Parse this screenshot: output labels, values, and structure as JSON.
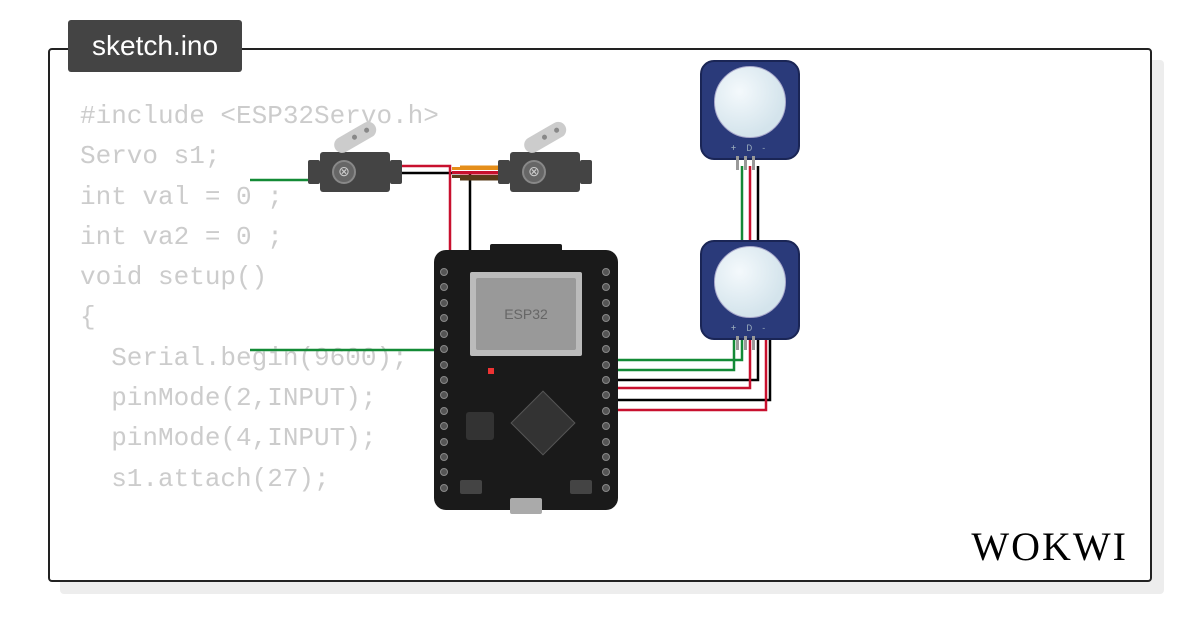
{
  "tab_label": "sketch.ino",
  "logo_text": "WOKWI",
  "code_text": "#include <ESP32Servo.h>\nServo s1;\nint val = 0 ;\nint va2 = 0 ;\nvoid setup()\n{\n  Serial.begin(9600);\n  pinMode(2,INPUT);\n  pinMode(4,INPUT);\n  s1.attach(27);",
  "board": {
    "chip_label": "ESP32"
  },
  "components": {
    "servo1": "wokwi-servo",
    "servo2": "wokwi-servo",
    "pir1": "wokwi-pir-motion-sensor",
    "pir2": "wokwi-pir-motion-sensor",
    "mcu": "wokwi-esp32-devkit-v1"
  },
  "pir_pin_label": "+ D -",
  "wire_colors": {
    "gnd": "#000000",
    "vcc": "#c8102e",
    "sig": "#138a36",
    "servo_sig": "#e58e1a",
    "servo_vcc": "#c8102e",
    "servo_gnd": "#5a3b1a"
  }
}
